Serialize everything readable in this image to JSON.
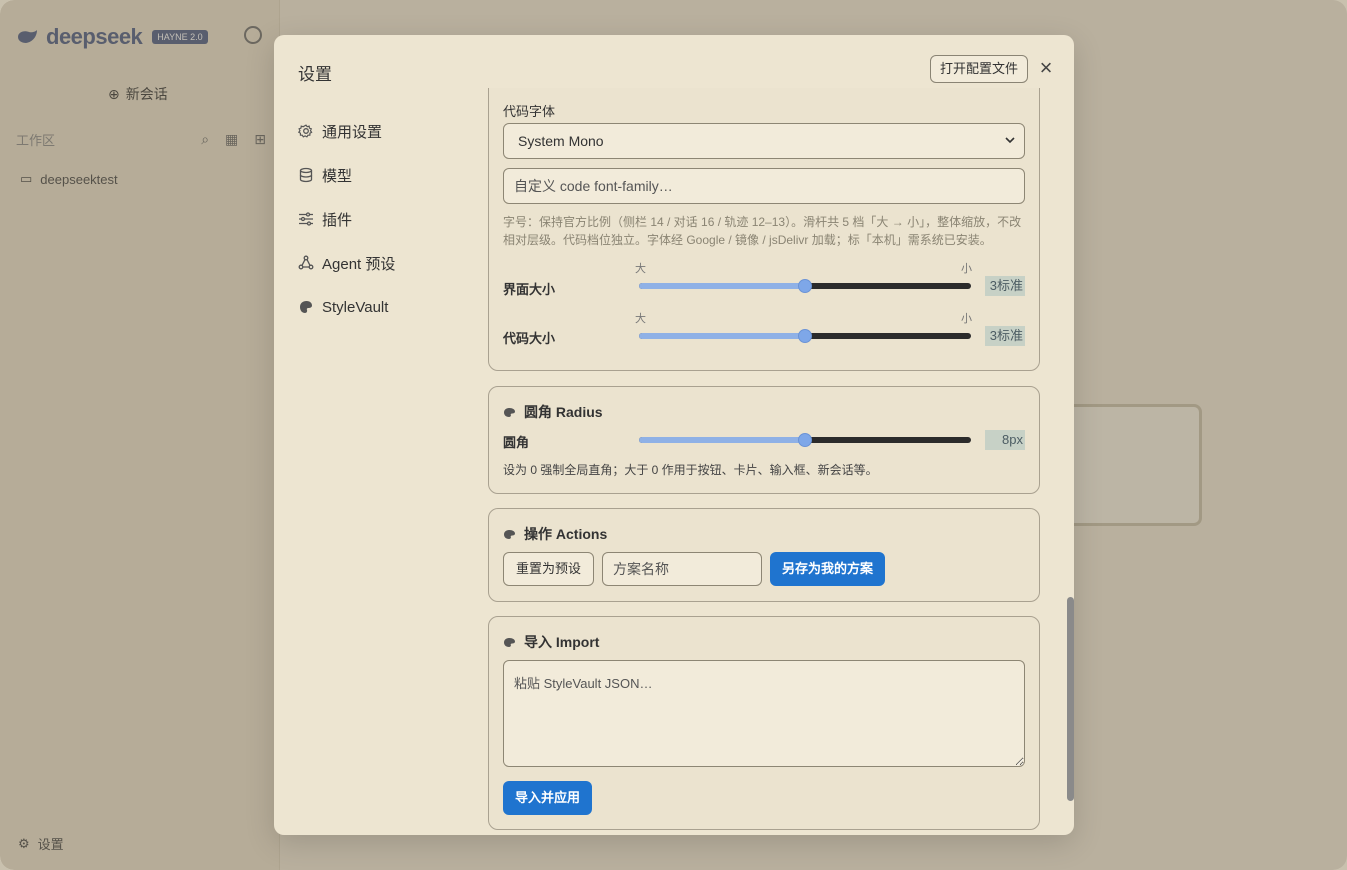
{
  "background": {
    "logo_text": "deepseek",
    "logo_badge": "HAYNE 2.0",
    "new_chat": "新会话",
    "workspace_label": "工作区",
    "workspace_item": "deepseektest",
    "settings_label": "设置"
  },
  "modal": {
    "title": "设置",
    "open_config_label": "打开配置文件",
    "close_label": "×",
    "nav": [
      {
        "label": "通用设置",
        "icon": "gear-icon"
      },
      {
        "label": "模型",
        "icon": "database-icon"
      },
      {
        "label": "插件",
        "icon": "sliders-icon"
      },
      {
        "label": "Agent 预设",
        "icon": "agent-icon"
      },
      {
        "label": "StyleVault",
        "icon": "palette-icon"
      }
    ]
  },
  "font_section": {
    "code_font_label": "代码字体",
    "code_font_value": "System Mono",
    "custom_font_placeholder": "自定义 code font-family…",
    "hint": "字号：保持官方比例（侧栏 14 / 对话 16 / 轨迹 12–13）。滑杆共 5 档「大 → 小」，整体缩放，不改相对层级。代码档位独立。字体经 Google / 镜像 / jsDelivr 加载；标「本机」需系统已安装。",
    "ui_size": {
      "label": "界面大小",
      "tick_left": "大",
      "tick_right": "小",
      "value_text": "3标准",
      "level": 3,
      "levels": 5
    },
    "code_size": {
      "label": "代码大小",
      "tick_left": "大",
      "tick_right": "小",
      "value_text": "3标准",
      "level": 3,
      "levels": 5
    }
  },
  "radius_section": {
    "title": "圆角 Radius",
    "label": "圆角",
    "value_text": "8px",
    "fraction": 0.5,
    "hint": "设为 0 强制全局直角；大于 0 作用于按钮、卡片、输入框、新会话等。"
  },
  "actions_section": {
    "title": "操作 Actions",
    "reset_label": "重置为预设",
    "name_placeholder": "方案名称",
    "save_label": "另存为我的方案"
  },
  "import_section": {
    "title": "导入 Import",
    "placeholder": "粘贴 StyleVault JSON…",
    "apply_label": "导入并应用"
  },
  "colors": {
    "primary": "#1f74cf",
    "slider_fill": "#8fb1e6",
    "panel_bg": "#ede5d1"
  }
}
